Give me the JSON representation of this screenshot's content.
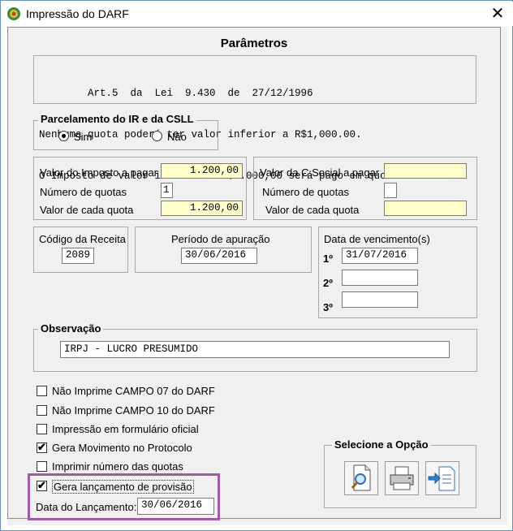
{
  "window": {
    "title": "Impressão do DARF",
    "close_symbol": "✕"
  },
  "section_title": "Parâmetros",
  "law_text": {
    "line1": "Art.5  da  Lei  9.430  de  27/12/1996",
    "line2": "Nenhuma quota poderá ter valor inferior a R$1,000.00.",
    "line3": "O Imposto de valor inferior a R$2.000,00 será pago em quota única."
  },
  "parcelamento": {
    "title": "Parcelamento do IR e da CSLL",
    "sim": "Sim",
    "nao": "Não",
    "selected": "Sim"
  },
  "ir": {
    "valor_label": "Valor do Imposto a pagar",
    "valor": "1.200,00",
    "quotas_label": "Número de quotas",
    "quotas": "1",
    "cada_label": "Valor de cada quota",
    "cada": "1.200,00"
  },
  "csll": {
    "valor_label": "Valor da C.Social a pagar",
    "valor": "",
    "quotas_label": "Número de quotas",
    "quotas": "",
    "cada_label": "Valor de cada quota",
    "cada": ""
  },
  "codigo": {
    "label": "Código da Receita",
    "value": "2089"
  },
  "periodo": {
    "label": "Período de apuração",
    "value": "30/06/2016"
  },
  "vencimento": {
    "label": "Data de vencimento(s)",
    "ord1": "1º",
    "date1": "31/07/2016",
    "ord2": "2º",
    "date2": "",
    "ord3": "3º",
    "date3": ""
  },
  "observacao": {
    "label": "Observação",
    "value": "IRPJ - LUCRO PRESUMIDO"
  },
  "checkboxes": [
    {
      "label": "Não Imprime CAMPO 07 do DARF",
      "checked": false
    },
    {
      "label": "Não Imprime CAMPO 10 do DARF",
      "checked": false
    },
    {
      "label": "Impressão em formulário oficial",
      "checked": false
    },
    {
      "label": "Gera Movimento no Protocolo",
      "checked": true
    },
    {
      "label": "Imprimir número das quotas",
      "checked": false
    },
    {
      "label": "Gera lançamento de provisão",
      "checked": true
    }
  ],
  "lancamento": {
    "label": "Data do Lançamento:",
    "value": "30/06/2016"
  },
  "opcoes": {
    "title": "Selecione a Opção",
    "buttons": [
      "preview-icon",
      "printer-icon",
      "export-icon"
    ]
  },
  "colors": {
    "highlight": "#a05aa8",
    "input_yellow": "#ffffcc"
  }
}
